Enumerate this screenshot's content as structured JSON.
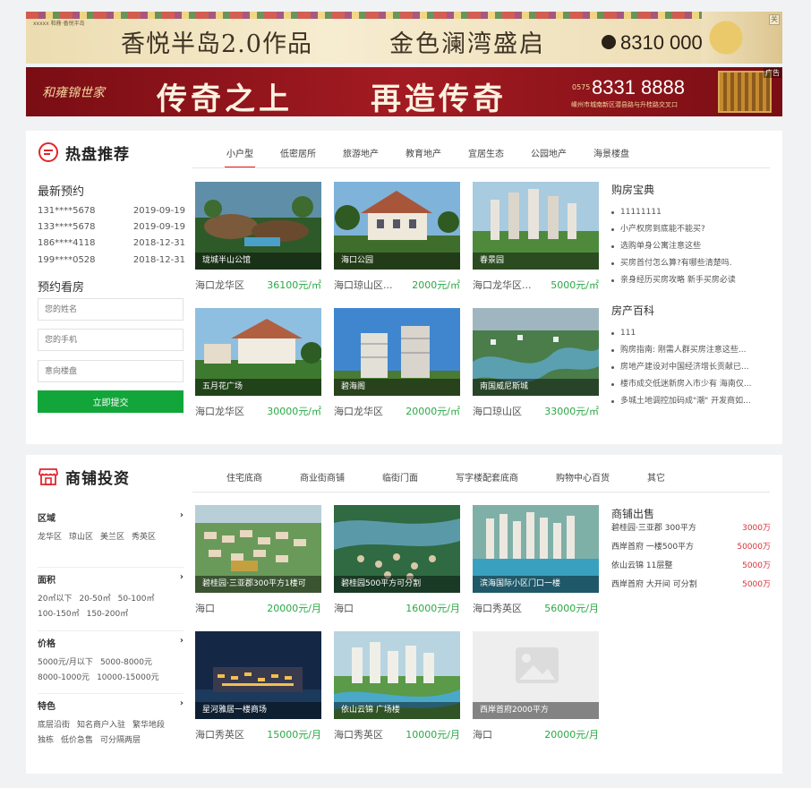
{
  "ads": {
    "top_logo": "xxxxx 和鼎·香悦半岛",
    "top_slogan_a": "香悦半岛2.0作品",
    "top_slogan_b": "金色澜湾盛启",
    "top_phone": "8310 0000",
    "close_label": "关",
    "second_brand": "和雍锦世家",
    "second_slogan_a": "传奇之上",
    "second_slogan_b": "再造传奇",
    "second_phone_prefix": "0575",
    "second_phone": "8331 8888",
    "second_address": "嵊州市城南新区潜县路与升桂路交叉口",
    "ad_label": "广告"
  },
  "hot": {
    "title": "热盘推荐",
    "tabs": [
      "小户型",
      "低密居所",
      "旅游地产",
      "教育地产",
      "宜居生态",
      "公园地产",
      "海景楼盘"
    ],
    "recent_title": "最新预约",
    "recent": [
      {
        "phone": "131****5678",
        "date": "2019-09-19"
      },
      {
        "phone": "133****5678",
        "date": "2019-09-19"
      },
      {
        "phone": "186****4118",
        "date": "2018-12-31"
      },
      {
        "phone": "199****0528",
        "date": "2018-12-31"
      }
    ],
    "booking_title": "预约看房",
    "name_placeholder": "您的姓名",
    "phone_placeholder": "您的手机",
    "property_placeholder": "意向楼盘",
    "submit_label": "立即提交",
    "cards": [
      {
        "caption": "珑城半山公馆",
        "loc": "海口龙华区",
        "price": "36100元/㎡"
      },
      {
        "caption": "海口公园",
        "loc": "海口琼山区...",
        "price": "2000元/㎡"
      },
      {
        "caption": "春景园",
        "loc": "海口龙华区...",
        "price": "5000元/㎡"
      },
      {
        "caption": "五月花广场",
        "loc": "海口龙华区",
        "price": "30000元/㎡"
      },
      {
        "caption": "碧海阁",
        "loc": "海口龙华区",
        "price": "20000元/㎡"
      },
      {
        "caption": "南国威尼斯城",
        "loc": "海口琼山区",
        "price": "33000元/㎡"
      }
    ],
    "guide_title": "购房宝典",
    "guide": [
      "11111111",
      "小产权房到底能不能买?",
      "选购单身公寓注意这些",
      "买房首付怎么算?有哪些清楚吗.",
      "亲身经历买房攻略 新手买房必读"
    ],
    "wiki_title": "房产百科",
    "wiki": [
      "111",
      "购房指南: 刚需人群买房注意这些...",
      "房地产建设对中国经济增长贡献已...",
      "楼市成交低迷新房入市少有 海南仅...",
      "多城土地调控加码成\"潮\" 开发商如..."
    ]
  },
  "shops": {
    "title": "商铺投资",
    "tabs": [
      "住宅底商",
      "商业街商铺",
      "临街门面",
      "写字楼配套底商",
      "购物中心百货",
      "其它"
    ],
    "filters": [
      {
        "name": "区域",
        "options": [
          "龙华区",
          "琼山区",
          "美兰区",
          "秀英区"
        ]
      },
      {
        "name": "面积",
        "options": [
          "20㎡以下",
          "20-50㎡",
          "50-100㎡",
          "100-150㎡",
          "150-200㎡"
        ]
      },
      {
        "name": "价格",
        "options": [
          "5000元/月以下",
          "5000-8000元",
          "8000-1000元",
          "10000-15000元"
        ]
      },
      {
        "name": "特色",
        "options": [
          "底层沿街",
          "知名商户入驻",
          "繁华地段",
          "独栋",
          "低价急售",
          "可分隔两层"
        ]
      }
    ],
    "arrow": "›",
    "cards": [
      {
        "caption": "碧桂园·三亚郡300平方1楼可",
        "loc": "海口",
        "price": "20000元/月"
      },
      {
        "caption": "碧桂园500平方可分割",
        "loc": "海口",
        "price": "16000元/月"
      },
      {
        "caption": "滨海国际小区门口一楼",
        "loc": "海口秀英区",
        "price": "56000元/月"
      },
      {
        "caption": "星河雅居一楼商场",
        "loc": "海口秀英区",
        "price": "15000元/月"
      },
      {
        "caption": "依山云锦 广场楼",
        "loc": "海口秀英区",
        "price": "10000元/月"
      },
      {
        "caption": "西岸首府2000平方",
        "loc": "海口",
        "price": "20000元/月"
      }
    ],
    "sale_title": "商铺出售",
    "sale": [
      {
        "name": "碧桂园·三亚郡 300平方",
        "price": "3000万"
      },
      {
        "name": "西岸首府 一楼500平方",
        "price": "50000万"
      },
      {
        "name": "依山云锦 11层整",
        "price": "5000万"
      },
      {
        "name": "西岸首府 大开间 可分割",
        "price": "5000万"
      }
    ]
  }
}
